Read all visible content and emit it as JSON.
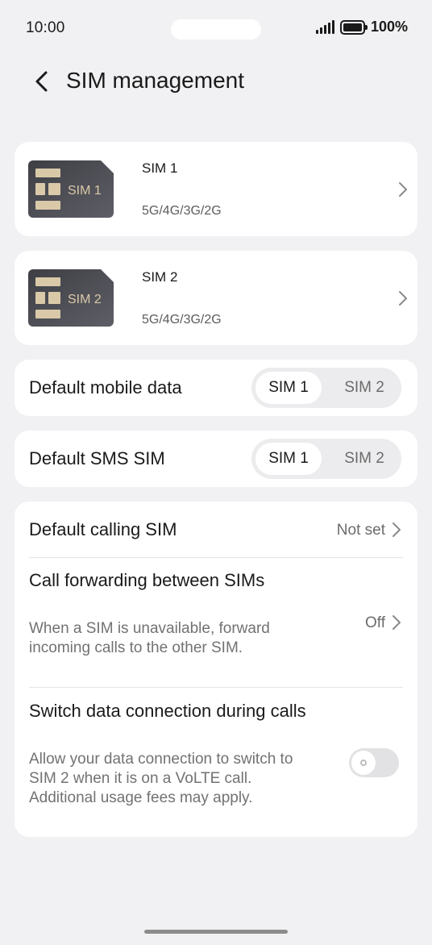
{
  "status_bar": {
    "time": "10:00",
    "battery": "100%"
  },
  "header": {
    "title": "SIM management"
  },
  "sims": [
    {
      "chip_label": "SIM 1",
      "name": "SIM 1",
      "network": "5G/4G/3G/2G"
    },
    {
      "chip_label": "SIM 2",
      "name": "SIM 2",
      "network": "5G/4G/3G/2G"
    }
  ],
  "default_data": {
    "label": "Default mobile data",
    "options": [
      "SIM 1",
      "SIM 2"
    ],
    "selected": "SIM 1"
  },
  "default_sms": {
    "label": "Default SMS SIM",
    "options": [
      "SIM 1",
      "SIM 2"
    ],
    "selected": "SIM 1"
  },
  "settings": {
    "calling": {
      "label": "Default calling SIM",
      "value": "Not set"
    },
    "forwarding": {
      "title": "Call forwarding between SIMs",
      "description": "When a SIM is unavailable, forward incoming calls to the other SIM.",
      "value": "Off"
    },
    "switch_data": {
      "title": "Switch data connection during calls",
      "description": "Allow your data connection to switch to SIM 2 when it is on a VoLTE call. Additional usage fees may apply.",
      "enabled": false
    }
  },
  "colors": {
    "background": "#f1f1f3",
    "card": "#ffffff",
    "chip_body": "#4a4a52",
    "chip_gold": "#d9c9a8"
  }
}
